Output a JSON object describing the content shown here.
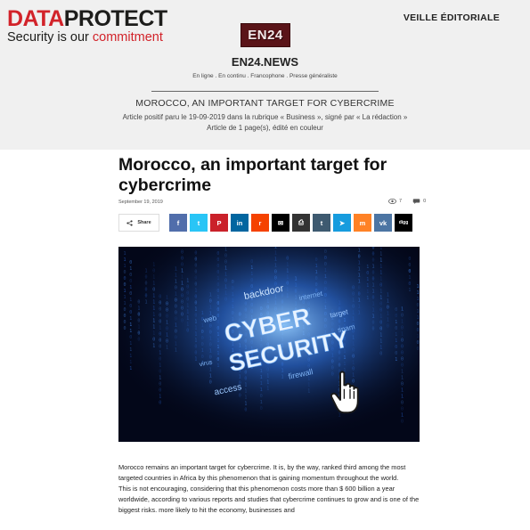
{
  "brand": {
    "name_part1": "DATA",
    "name_part2": "PROTECT",
    "tagline_prefix": "Security is our ",
    "tagline_accent": "commitment"
  },
  "veille_label": "VEILLE ÉDITORIALE",
  "publication": {
    "logo_text": "EN24",
    "name": "EN24.NEWS",
    "description": "En ligne . En continu . Francophone . Presse généraliste"
  },
  "clipping": {
    "heading": "MOROCCO, AN IMPORTANT TARGET FOR CYBERCRIME",
    "line1": "Article positif paru le 19-09-2019 dans la rubrique « Business », signé par « La rédaction »",
    "line2": "Article de 1 page(s), édité en couleur"
  },
  "article": {
    "title": "Morocco, an important target for cybercrime",
    "date": "September 19, 2019",
    "views": "7",
    "comments": "0",
    "share_label": "Share",
    "paragraph1": "Morocco remains an important target for cybercrime. It is, by the way, ranked third among the most targeted countries in Africa by this phenomenon that is gaining momentum throughout the world.",
    "paragraph2": "This is not encouraging, considering that this phenomenon costs more than $ 600 billion a year worldwide, according to various reports and studies that cybercrime continues to grow and is one of the biggest risks. more likely to hit the economy, businesses and"
  },
  "hero_image": {
    "words": [
      "CYBER",
      "SECURITY",
      "backdoor",
      "access",
      "web",
      "internet",
      "firewall",
      "spam",
      "target",
      "virus"
    ]
  },
  "social_buttons": [
    {
      "name": "facebook",
      "glyph": "f",
      "color": "#516eab"
    },
    {
      "name": "twitter",
      "glyph": "t",
      "color": "#29c5f6"
    },
    {
      "name": "pinterest",
      "glyph": "P",
      "color": "#ca212a"
    },
    {
      "name": "linkedin",
      "glyph": "in",
      "color": "#0266a0"
    },
    {
      "name": "reddit",
      "glyph": "r",
      "color": "#f54200"
    },
    {
      "name": "email",
      "glyph": "✉",
      "color": "#000000"
    },
    {
      "name": "print",
      "glyph": "⎙",
      "color": "#333333"
    },
    {
      "name": "tumblr",
      "glyph": "t",
      "color": "#3e5a70"
    },
    {
      "name": "telegram",
      "glyph": "➤",
      "color": "#179cde"
    },
    {
      "name": "mix",
      "glyph": "m",
      "color": "#ff8226"
    },
    {
      "name": "vk",
      "glyph": "vk",
      "color": "#4c75a3"
    },
    {
      "name": "digg",
      "glyph": "digg",
      "color": "#000000"
    }
  ]
}
